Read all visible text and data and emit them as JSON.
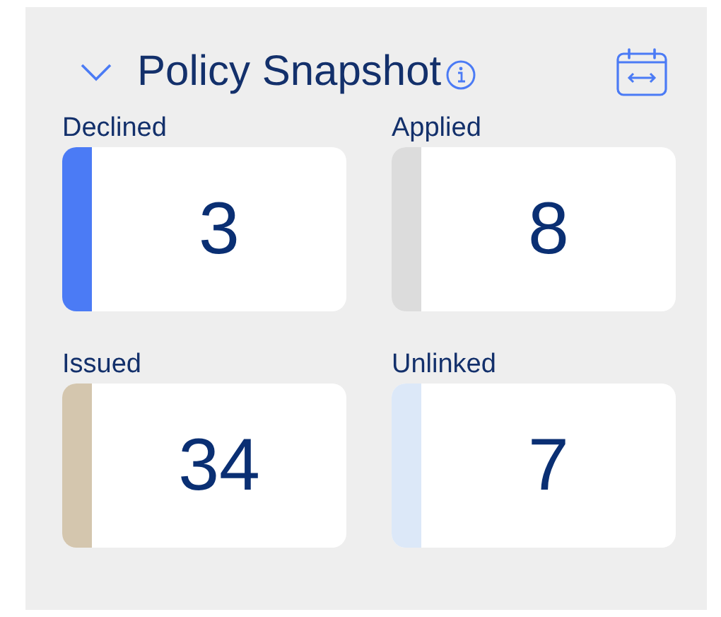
{
  "panel": {
    "title": "Policy Snapshot",
    "expanded": true
  },
  "tiles": [
    {
      "label": "Declined",
      "value": "3",
      "color": "#4b7bf5"
    },
    {
      "label": "Applied",
      "value": "8",
      "color": "#dcdcdc"
    },
    {
      "label": "Issued",
      "value": "34",
      "color": "#d4c6ae"
    },
    {
      "label": "Unlinked",
      "value": "7",
      "color": "#dce8f8"
    }
  ]
}
